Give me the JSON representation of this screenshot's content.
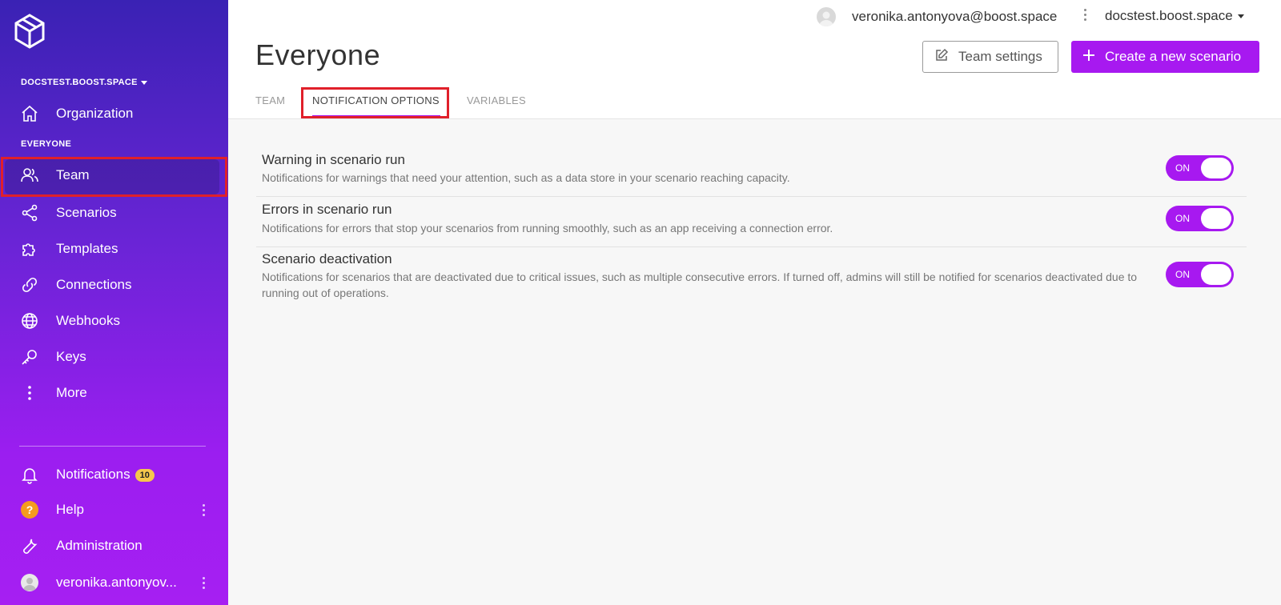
{
  "sidebar": {
    "org_switch": "DOCSTEST.BOOST.SPACE",
    "section_label": "EVERYONE",
    "organization_label": "Organization",
    "items": [
      {
        "label": "Team",
        "icon": "users-icon"
      },
      {
        "label": "Scenarios",
        "icon": "share-icon"
      },
      {
        "label": "Templates",
        "icon": "puzzle-icon"
      },
      {
        "label": "Connections",
        "icon": "link-icon"
      },
      {
        "label": "Webhooks",
        "icon": "globe-icon"
      },
      {
        "label": "Keys",
        "icon": "key-icon"
      },
      {
        "label": "More",
        "icon": "more-vertical-icon"
      }
    ],
    "bottom": {
      "notifications_label": "Notifications",
      "notifications_count": "10",
      "help_label": "Help",
      "administration_label": "Administration",
      "user_label": "veronika.antonyov..."
    }
  },
  "topbar": {
    "user_email": "veronika.antonyova@boost.space",
    "org_dropdown": "docstest.boost.space"
  },
  "page": {
    "title": "Everyone",
    "team_settings_label": "Team settings",
    "create_scenario_label": "Create a new scenario"
  },
  "tabs": [
    {
      "label": "TEAM",
      "active": false
    },
    {
      "label": "NOTIFICATION OPTIONS",
      "active": true
    },
    {
      "label": "VARIABLES",
      "active": false
    }
  ],
  "options": [
    {
      "title": "Warning in scenario run",
      "description": "Notifications for warnings that need your attention, such as a data store in your scenario reaching capacity.",
      "toggle": "ON"
    },
    {
      "title": "Errors in scenario run",
      "description": "Notifications for errors that stop your scenarios from running smoothly, such as an app receiving a connection error.",
      "toggle": "ON"
    },
    {
      "title": "Scenario deactivation",
      "description": "Notifications for scenarios that are deactivated due to critical issues, such as multiple consecutive errors. If turned off, admins will still be notified for scenarios deactivated due to running out of operations.",
      "toggle": "ON"
    }
  ],
  "colors": {
    "accent": "#a719f0",
    "highlight": "#e0202a",
    "sidebar_top": "#3a22b4",
    "sidebar_bottom": "#a61ff2"
  }
}
